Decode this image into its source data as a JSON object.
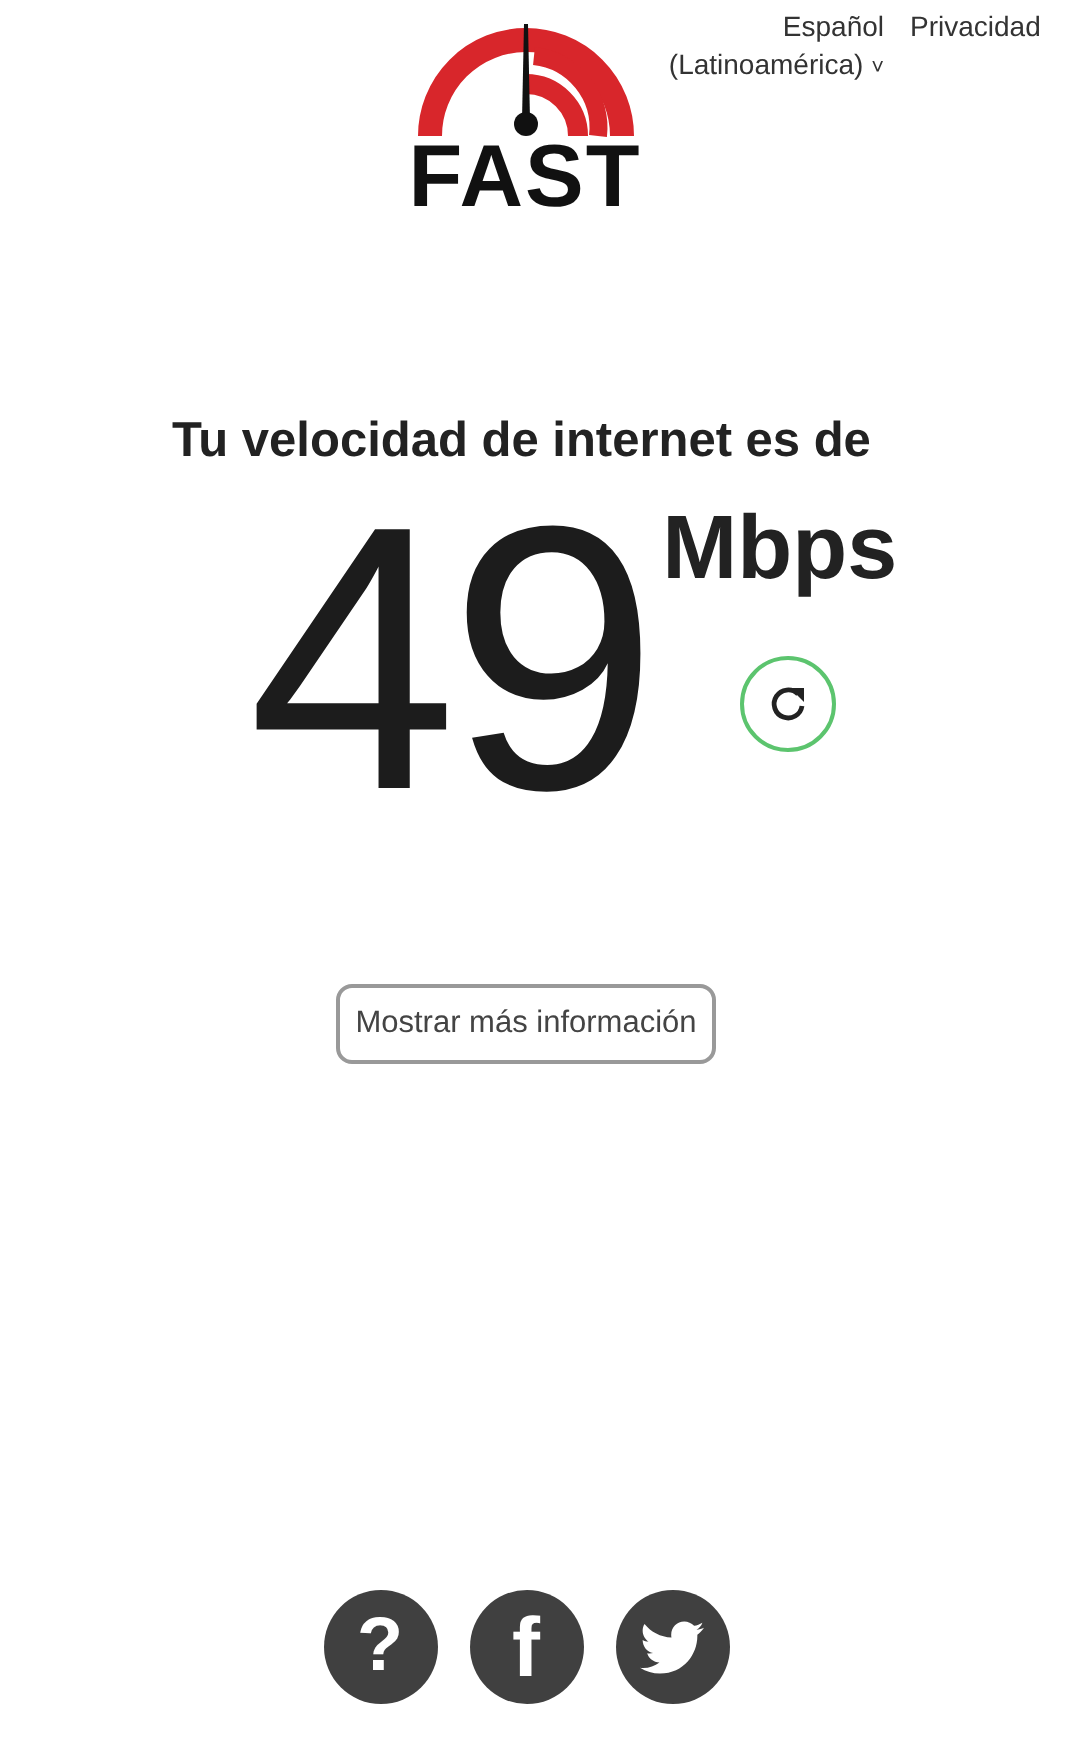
{
  "logo": {
    "text": "FAST"
  },
  "header": {
    "language": {
      "line1": "Español",
      "line2": "(Latinoamérica)",
      "caret": "˅"
    },
    "privacy": "Privacidad"
  },
  "result": {
    "heading": "Tu velocidad de internet es de",
    "value": "49",
    "unit": "Mbps"
  },
  "more_button": "Mostrar más información",
  "footer": [
    {
      "kind": "help",
      "glyph": "?"
    },
    {
      "kind": "facebook",
      "glyph": "f"
    },
    {
      "kind": "twitter"
    }
  ]
}
